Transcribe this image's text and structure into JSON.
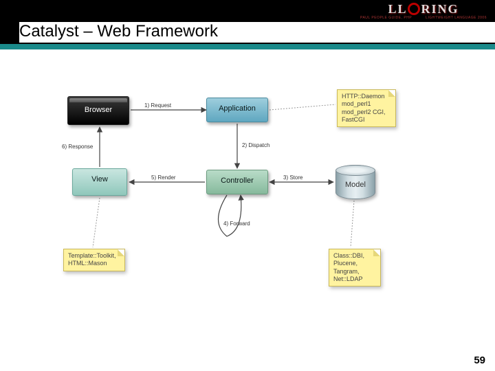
{
  "header": {
    "logo_text_left": "LL",
    "logo_text_right": "RING",
    "logo_sub_left": "PAUL PEOPLE GUIDE, PHP",
    "logo_sub_right": "LIGHTWEIGHT LANGUAGE 2006"
  },
  "title": "Catalyst – Web Framework",
  "diagram": {
    "nodes": {
      "browser": "Browser",
      "application": "Application",
      "view": "View",
      "controller": "Controller",
      "model": "Model"
    },
    "edges": {
      "request": "1) Request",
      "dispatch": "2) Dispatch",
      "store": "3) Store",
      "forward": "4) Forward",
      "render": "5) Render",
      "response": "6) Response"
    },
    "notes": {
      "app": "HTTP::Daemon\nmod_perl1\nmod_perl2\nCGI, FastCGI",
      "view": "Template::Toolkit,\nHTML::Mason",
      "model": "Class::DBI,\nPlucene,\nTangram,\nNet::LDAP"
    }
  },
  "page_number": "59"
}
